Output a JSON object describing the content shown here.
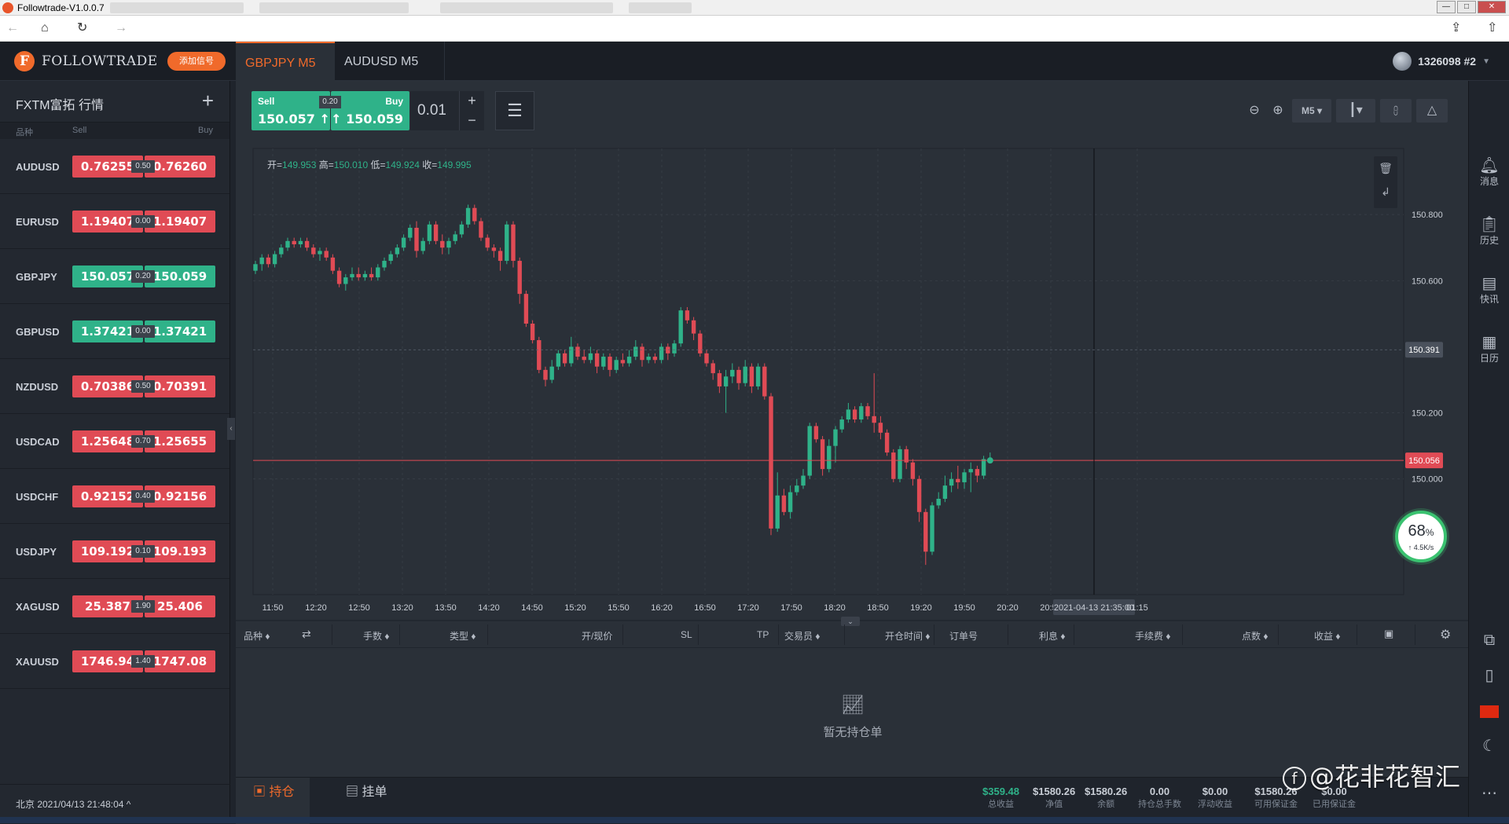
{
  "window": {
    "title": "Followtrade-V1.0.0.7"
  },
  "header": {
    "logo": "FOLLOWTRADE",
    "add_signal": "添加信号",
    "tabs": [
      {
        "label": "GBPJPY M5"
      },
      {
        "label": "AUDUSD M5"
      }
    ],
    "account": "1326098 #2"
  },
  "sidebar": {
    "title": "FXTM富拓 行情",
    "cols": {
      "symbol": "品种",
      "sell": "Sell",
      "buy": "Buy"
    },
    "quotes": [
      {
        "symbol": "AUDUSD",
        "sell": "0.76255",
        "spread": "0.50",
        "buy": "0.76260",
        "color": "red"
      },
      {
        "symbol": "EURUSD",
        "sell": "1.19407",
        "spread": "0.00",
        "buy": "1.19407",
        "color": "red"
      },
      {
        "symbol": "GBPJPY",
        "sell": "150.057",
        "spread": "0.20",
        "buy": "150.059",
        "color": "green"
      },
      {
        "symbol": "GBPUSD",
        "sell": "1.37421",
        "spread": "0.00",
        "buy": "1.37421",
        "color": "green"
      },
      {
        "symbol": "NZDUSD",
        "sell": "0.70386",
        "spread": "0.50",
        "buy": "0.70391",
        "color": "red"
      },
      {
        "symbol": "USDCAD",
        "sell": "1.25648",
        "spread": "0.70",
        "buy": "1.25655",
        "color": "red"
      },
      {
        "symbol": "USDCHF",
        "sell": "0.92152",
        "spread": "0.40",
        "buy": "0.92156",
        "color": "red"
      },
      {
        "symbol": "USDJPY",
        "sell": "109.192",
        "spread": "0.10",
        "buy": "109.193",
        "color": "red"
      },
      {
        "symbol": "XAGUSD",
        "sell": "25.387",
        "spread": "1.90",
        "buy": "25.406",
        "color": "red"
      },
      {
        "symbol": "XAUUSD",
        "sell": "1746.94",
        "spread": "1.40",
        "buy": "1747.08",
        "color": "red"
      }
    ],
    "footer": "北京 2021/04/13 21:48:04 ^"
  },
  "trade": {
    "sell_label": "Sell",
    "sell_price": "150.057 ↑",
    "buy_label": "Buy",
    "buy_price": "↑ 150.059",
    "spread": "0.20",
    "lot": "0.01",
    "timeframe": "M5"
  },
  "chart": {
    "ohlc": {
      "o_label": "开=",
      "o": "149.953",
      "h_label": "高=",
      "h": "150.010",
      "l_label": "低=",
      "l": "149.924",
      "c_label": "收=",
      "c": "149.995"
    },
    "gauge": {
      "percent": "68",
      "percent_sign": "%",
      "speed": "↑ 4.5K/s"
    },
    "colors": {
      "up": "#2fb289",
      "down": "#e04b55",
      "background": "#2a3038",
      "grid": "#3a404a",
      "price_line": "#e04b55"
    }
  },
  "chart_data": {
    "type": "candlestick",
    "symbol": "GBPJPY",
    "timeframe": "M5",
    "y_ticks": [
      150.8,
      150.6,
      150.2,
      150.0
    ],
    "y_tick_labels": [
      "150.800",
      "150.600",
      "150.200",
      "150.000"
    ],
    "ylim": [
      149.65,
      151.0
    ],
    "x_tick_labels": [
      "11:50",
      "12:20",
      "12:50",
      "13:20",
      "13:50",
      "14:20",
      "14:50",
      "15:20",
      "15:50",
      "16:20",
      "16:50",
      "17:20",
      "17:50",
      "18:20",
      "18:50",
      "19:20",
      "19:50",
      "20:20",
      "20:50",
      "2021-04-13 21:35:00",
      "01:15"
    ],
    "crosshair_price": "150.391",
    "last_price": "150.056",
    "candles": [
      [
        150.63,
        150.66,
        150.62,
        150.65
      ],
      [
        150.65,
        150.68,
        150.63,
        150.67
      ],
      [
        150.67,
        150.68,
        150.64,
        150.65
      ],
      [
        150.65,
        150.69,
        150.64,
        150.68
      ],
      [
        150.68,
        150.71,
        150.67,
        150.7
      ],
      [
        150.7,
        150.73,
        150.69,
        150.72
      ],
      [
        150.72,
        150.73,
        150.7,
        150.71
      ],
      [
        150.71,
        150.73,
        150.7,
        150.72
      ],
      [
        150.72,
        150.73,
        150.69,
        150.7
      ],
      [
        150.7,
        150.71,
        150.67,
        150.68
      ],
      [
        150.68,
        150.7,
        150.66,
        150.69
      ],
      [
        150.69,
        150.7,
        150.66,
        150.67
      ],
      [
        150.67,
        150.68,
        150.62,
        150.63
      ],
      [
        150.63,
        150.64,
        150.58,
        150.59
      ],
      [
        150.59,
        150.62,
        150.57,
        150.61
      ],
      [
        150.61,
        150.64,
        150.6,
        150.62
      ],
      [
        150.62,
        150.64,
        150.6,
        150.61
      ],
      [
        150.61,
        150.63,
        150.6,
        150.62
      ],
      [
        150.62,
        150.64,
        150.6,
        150.61
      ],
      [
        150.61,
        150.65,
        150.6,
        150.64
      ],
      [
        150.64,
        150.67,
        150.63,
        150.66
      ],
      [
        150.66,
        150.69,
        150.65,
        150.68
      ],
      [
        150.68,
        150.71,
        150.67,
        150.7
      ],
      [
        150.7,
        150.74,
        150.69,
        150.73
      ],
      [
        150.73,
        150.77,
        150.72,
        150.76
      ],
      [
        150.76,
        150.78,
        150.67,
        150.69
      ],
      [
        150.69,
        150.73,
        150.68,
        150.72
      ],
      [
        150.72,
        150.78,
        150.71,
        150.77
      ],
      [
        150.77,
        150.78,
        150.71,
        150.72
      ],
      [
        150.72,
        150.74,
        150.68,
        150.7
      ],
      [
        150.7,
        150.73,
        150.68,
        150.72
      ],
      [
        150.72,
        150.75,
        150.71,
        150.74
      ],
      [
        150.74,
        150.78,
        150.73,
        150.77
      ],
      [
        150.77,
        150.83,
        150.76,
        150.82
      ],
      [
        150.82,
        150.83,
        150.77,
        150.78
      ],
      [
        150.78,
        150.79,
        150.72,
        150.73
      ],
      [
        150.73,
        150.74,
        150.69,
        150.7
      ],
      [
        150.7,
        150.71,
        150.67,
        150.69
      ],
      [
        150.69,
        150.7,
        150.63,
        150.66
      ],
      [
        150.66,
        150.78,
        150.65,
        150.77
      ],
      [
        150.77,
        150.78,
        150.64,
        150.66
      ],
      [
        150.66,
        150.67,
        150.53,
        150.56
      ],
      [
        150.56,
        150.57,
        150.46,
        150.47
      ],
      [
        150.47,
        150.48,
        150.41,
        150.42
      ],
      [
        150.42,
        150.43,
        150.32,
        150.33
      ],
      [
        150.33,
        150.34,
        150.28,
        150.3
      ],
      [
        150.3,
        150.36,
        150.29,
        150.34
      ],
      [
        150.34,
        150.39,
        150.33,
        150.38
      ],
      [
        150.38,
        150.39,
        150.34,
        150.35
      ],
      [
        150.35,
        150.43,
        150.34,
        150.4
      ],
      [
        150.4,
        150.41,
        150.36,
        150.37
      ],
      [
        150.37,
        150.39,
        150.35,
        150.36
      ],
      [
        150.36,
        150.4,
        150.35,
        150.38
      ],
      [
        150.38,
        150.39,
        150.32,
        150.34
      ],
      [
        150.34,
        150.38,
        150.33,
        150.37
      ],
      [
        150.37,
        150.38,
        150.31,
        150.33
      ],
      [
        150.33,
        150.37,
        150.32,
        150.36
      ],
      [
        150.36,
        150.38,
        150.34,
        150.35
      ],
      [
        150.35,
        150.39,
        150.34,
        150.37
      ],
      [
        150.37,
        150.42,
        150.36,
        150.4
      ],
      [
        150.4,
        150.41,
        150.34,
        150.36
      ],
      [
        150.36,
        150.38,
        150.35,
        150.37
      ],
      [
        150.37,
        150.38,
        150.35,
        150.36
      ],
      [
        150.36,
        150.41,
        150.35,
        150.4
      ],
      [
        150.4,
        150.41,
        150.36,
        150.38
      ],
      [
        150.38,
        150.42,
        150.37,
        150.41
      ],
      [
        150.41,
        150.52,
        150.4,
        150.51
      ],
      [
        150.51,
        150.52,
        150.47,
        150.48
      ],
      [
        150.48,
        150.49,
        150.42,
        150.44
      ],
      [
        150.44,
        150.45,
        150.37,
        150.38
      ],
      [
        150.38,
        150.39,
        150.34,
        150.35
      ],
      [
        150.35,
        150.36,
        150.3,
        150.32
      ],
      [
        150.32,
        150.33,
        150.26,
        150.28
      ],
      [
        150.28,
        150.33,
        150.2,
        150.31
      ],
      [
        150.31,
        150.35,
        150.29,
        150.33
      ],
      [
        150.33,
        150.34,
        150.27,
        150.29
      ],
      [
        150.29,
        150.36,
        150.28,
        150.34
      ],
      [
        150.34,
        150.35,
        150.26,
        150.28
      ],
      [
        150.28,
        150.35,
        150.27,
        150.34
      ],
      [
        150.34,
        150.35,
        150.24,
        150.25
      ],
      [
        150.25,
        150.26,
        149.83,
        149.85
      ],
      [
        149.85,
        150.02,
        149.84,
        149.95
      ],
      [
        149.95,
        149.97,
        149.89,
        149.9
      ],
      [
        149.9,
        149.98,
        149.88,
        149.96
      ],
      [
        149.96,
        150.0,
        149.95,
        149.98
      ],
      [
        149.98,
        150.03,
        149.97,
        150.01
      ],
      [
        150.01,
        150.17,
        150.0,
        150.16
      ],
      [
        150.16,
        150.17,
        150.11,
        150.12
      ],
      [
        150.12,
        150.13,
        150.01,
        150.03
      ],
      [
        150.03,
        150.12,
        150.02,
        150.1
      ],
      [
        150.1,
        150.16,
        150.05,
        150.15
      ],
      [
        150.15,
        150.19,
        150.14,
        150.18
      ],
      [
        150.18,
        150.23,
        150.17,
        150.21
      ],
      [
        150.21,
        150.22,
        150.17,
        150.18
      ],
      [
        150.18,
        150.23,
        150.17,
        150.22
      ],
      [
        150.22,
        150.23,
        150.18,
        150.19
      ],
      [
        150.19,
        150.32,
        150.14,
        150.17
      ],
      [
        150.17,
        150.19,
        150.12,
        150.14
      ],
      [
        150.14,
        150.15,
        150.07,
        150.08
      ],
      [
        150.08,
        150.09,
        149.99,
        150.0
      ],
      [
        150.0,
        150.1,
        149.99,
        150.09
      ],
      [
        150.09,
        150.1,
        150.03,
        150.05
      ],
      [
        150.05,
        150.06,
        149.98,
        150.0
      ],
      [
        150.0,
        150.01,
        149.87,
        149.9
      ],
      [
        149.9,
        149.91,
        149.74,
        149.78
      ],
      [
        149.78,
        149.93,
        149.77,
        149.92
      ],
      [
        149.92,
        149.96,
        149.91,
        149.94
      ],
      [
        149.94,
        150.01,
        149.93,
        149.98
      ],
      [
        149.98,
        150.02,
        149.96,
        150.0
      ],
      [
        150.0,
        150.04,
        149.97,
        149.99
      ],
      [
        149.99,
        150.03,
        149.97,
        150.02
      ],
      [
        150.02,
        150.05,
        149.96,
        150.03
      ],
      [
        150.03,
        150.04,
        149.99,
        150.01
      ],
      [
        150.01,
        150.07,
        150.0,
        150.06
      ],
      [
        150.06,
        150.08,
        150.05,
        150.06
      ]
    ]
  },
  "orders": {
    "columns": [
      "品种 ♦",
      "⇄",
      "手数 ♦",
      "类型 ♦",
      "开/现价",
      "SL",
      "TP",
      "交易员 ♦",
      "开仓时间 ♦",
      "订单号",
      "利息 ♦",
      "手续费 ♦",
      "点数 ♦",
      "收益 ♦"
    ],
    "empty": "暂无持仓单"
  },
  "bottom": {
    "tabs": [
      "持仓",
      "挂单"
    ],
    "stats": [
      {
        "value": "$359.48",
        "label": "总收益",
        "color": "green"
      },
      {
        "value": "$1580.26",
        "label": "净值"
      },
      {
        "value": "$1580.26",
        "label": "余额"
      },
      {
        "value": "0.00",
        "label": "持仓总手数"
      },
      {
        "value": "$0.00",
        "label": "浮动收益"
      },
      {
        "value": "$1580.26",
        "label": "可用保证金"
      },
      {
        "value": "$0.00",
        "label": "已用保证金"
      }
    ]
  },
  "rail": {
    "items": [
      "消息",
      "历史",
      "快讯",
      "日历"
    ]
  },
  "watermark": "@花非花智汇"
}
